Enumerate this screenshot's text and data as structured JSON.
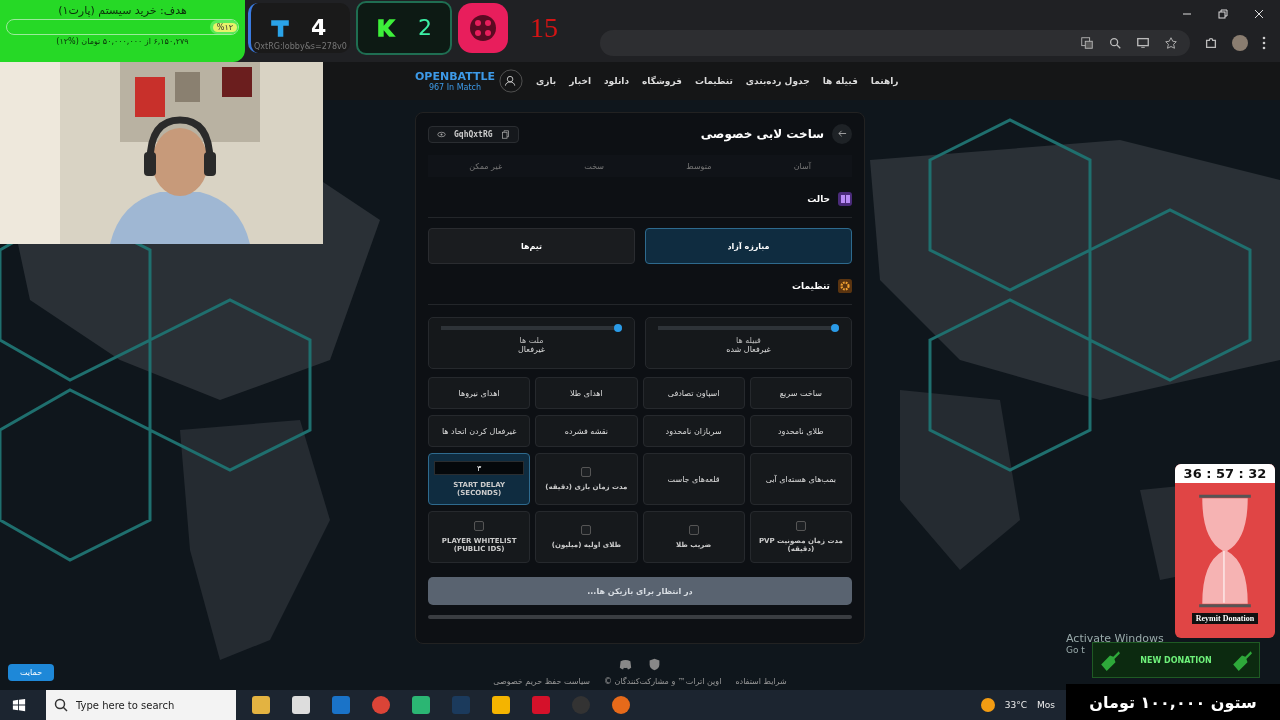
{
  "overlay": {
    "goal": {
      "title": "هدف: خرید سیستم (پارت۱)",
      "percent": "%۱۲",
      "level": 0.12,
      "detail": "۶,۱۵۰,۲۷۹ از ۵۰,۰۰۰,۰۰۰ تومان (%۱۲)"
    },
    "counters": [
      {
        "kind": "dice",
        "value": "15"
      },
      {
        "kind": "k",
        "value": "2"
      },
      {
        "kind": "t",
        "value": "4",
        "caption": "QxtRG:lobby&s=278v0"
      }
    ],
    "timer": {
      "time": "36 : 57 : 32",
      "caption": "Reymit Donation"
    },
    "donation": {
      "label": "NEW DONATION",
      "total": "ستون ۱۰۰,۰۰۰ تومان"
    },
    "activation": {
      "title": "Activate Windows",
      "subtitle": "Go t"
    },
    "support_button": "حمایت"
  },
  "site": {
    "logo": "OPENBATTLE",
    "in_match": "967 In Match",
    "nav": [
      "راهنما",
      "قبیله ها",
      "جدول رده‌بندی",
      "تنظیمات",
      "فروشگاه",
      "دانلود",
      "اخبار",
      "بازی"
    ],
    "footer": [
      "شرایط استفاده",
      "اوپن اترات™ و مشارکت‌کنندگان ©",
      "سیاست حفظ حریم خصوصی"
    ]
  },
  "modal": {
    "title": "ساخت لابی خصوصی",
    "code": "GqhQxtRG",
    "difficulties": [
      "آسان",
      "متوسط",
      "سخت",
      "غیر ممکن"
    ],
    "mode_title": "حالت",
    "modes": [
      {
        "label": "مبارزه آزاد",
        "selected": true
      },
      {
        "label": "تیم‌ها",
        "selected": false
      }
    ],
    "settings_title": "تنظیمات",
    "sliders": [
      {
        "title": "قبیله ها",
        "value": "غیرفعال شده",
        "level": 0
      },
      {
        "title": "ملت ها",
        "value": "غیرفعال",
        "level": 0
      }
    ],
    "options": [
      {
        "kind": "toggle",
        "label": "ساخت سریع",
        "selected": false
      },
      {
        "kind": "toggle",
        "label": "اسپاون تصادفی",
        "selected": false
      },
      {
        "kind": "toggle",
        "label": "اهدای طلا",
        "selected": false
      },
      {
        "kind": "toggle",
        "label": "اهدای نیروها",
        "selected": false
      },
      {
        "kind": "toggle",
        "label": "طلای نامحدود",
        "selected": false
      },
      {
        "kind": "toggle",
        "label": "سربازان نامحدود",
        "selected": false
      },
      {
        "kind": "toggle",
        "label": "نقشه فشرده",
        "selected": false
      },
      {
        "kind": "toggle",
        "label": "غیرفعال کردن اتحاد ها",
        "selected": false
      },
      {
        "kind": "toggle",
        "label": "بمب‌های هسته‌ای آبی",
        "selected": false
      },
      {
        "kind": "toggle",
        "label": "قلعه‌های جاست",
        "selected": false
      },
      {
        "kind": "checkbox",
        "label": "مدت زمان بازی (دقیقه)",
        "checked": false,
        "selected": false
      },
      {
        "kind": "number",
        "label": "START DELAY (SECONDS)",
        "value": "۳",
        "selected": true
      },
      {
        "kind": "checkbox",
        "label": "مدت زمان مصونیت PVP (دقیقه)",
        "checked": false,
        "selected": false
      },
      {
        "kind": "checkbox",
        "label": "ضریب طلا",
        "checked": false,
        "selected": false
      },
      {
        "kind": "checkbox",
        "label": "طلای اولیه (میلیون)",
        "checked": false,
        "selected": false
      },
      {
        "kind": "checkbox",
        "label": "PLAYER WHITELIST (PUBLIC IDS)",
        "checked": false,
        "selected": false
      }
    ],
    "wait_button": "در انتظار برای بازیکن ها..."
  },
  "taskbar": {
    "search_placeholder": "Type here to search",
    "temperature": "33°C",
    "weather": "Mos"
  }
}
